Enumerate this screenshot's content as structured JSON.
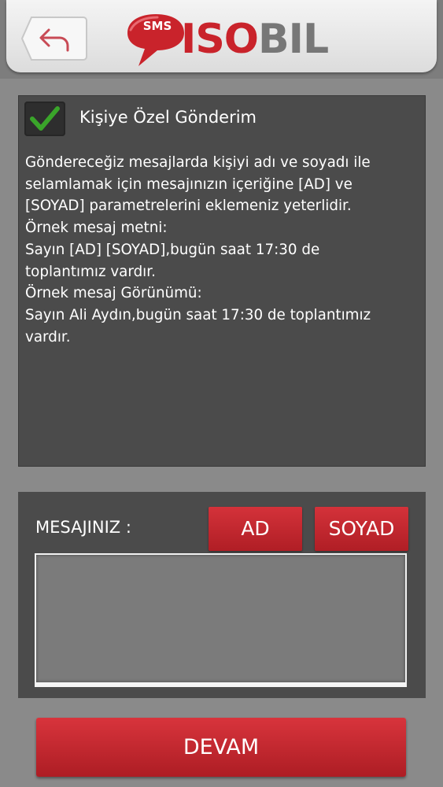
{
  "header": {
    "back_icon": "back-arrow-icon",
    "logo": {
      "badge": "SMS",
      "text_red": "ISO",
      "text_gray": "BIL"
    }
  },
  "info": {
    "checkbox_checked": true,
    "checkbox_label": "Kişiye Özel Gönderim",
    "lines": [
      "Göndereceğiz mesajlarda kişiyi adı ve soyadı ile",
      "selamlamak için mesajınızın içeriğine [AD] ve",
      "[SOYAD] parametrelerini eklemeniz yeterlidir.",
      "Örnek mesaj metni:",
      "Sayın [AD] [SOYAD],bugün saat 17:30 de",
      "toplantımız vardır.",
      "Örnek mesaj Görünümü:",
      "Sayın Ali Aydın,bugün saat 17:30 de toplantımız",
      "vardır."
    ]
  },
  "message": {
    "label": "MESAJINIZ :",
    "ad_button": "AD",
    "soyad_button": "SOYAD",
    "value": ""
  },
  "devam_button": "DEVAM",
  "colors": {
    "accent_red": "#c9232b",
    "panel": "#4b4b4b",
    "background": "#8a8a8a",
    "check_green": "#3aa52a"
  }
}
